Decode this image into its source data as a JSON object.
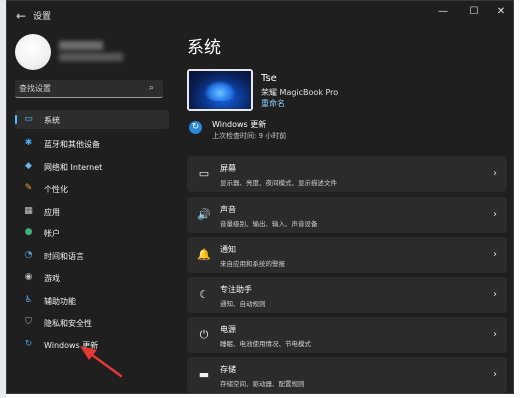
{
  "window": {
    "title": "设置",
    "back_glyph": "←",
    "minimize_glyph": "—",
    "maximize_glyph": "☐",
    "close_glyph": "✕"
  },
  "search": {
    "placeholder": "查找设置"
  },
  "sidebar": {
    "items": [
      {
        "label": "系统",
        "icon": "▭",
        "icon_name": "system-icon",
        "icon_color": "#4cc2ff",
        "active": true
      },
      {
        "label": "蓝牙和其他设备",
        "icon": "✱",
        "icon_name": "bluetooth-icon",
        "icon_color": "#4aa8f0",
        "active": false
      },
      {
        "label": "网络和 Internet",
        "icon": "◆",
        "icon_name": "network-icon",
        "icon_color": "#67b5f0",
        "active": false
      },
      {
        "label": "个性化",
        "icon": "✎",
        "icon_name": "personalization-icon",
        "icon_color": "#f0a030",
        "active": false
      },
      {
        "label": "应用",
        "icon": "▦",
        "icon_name": "apps-icon",
        "icon_color": "#c8c8c8",
        "active": false
      },
      {
        "label": "帐户",
        "icon": "●",
        "icon_name": "account-icon",
        "icon_color": "#3fb27f",
        "active": false
      },
      {
        "label": "时间和语言",
        "icon": "◔",
        "icon_name": "time-language-icon",
        "icon_color": "#52a8e8",
        "active": false
      },
      {
        "label": "游戏",
        "icon": "◉",
        "icon_name": "gaming-icon",
        "icon_color": "#b9b9b9",
        "active": false
      },
      {
        "label": "辅助功能",
        "icon": "♿",
        "icon_name": "accessibility-icon",
        "icon_color": "#5aa7e6",
        "active": false
      },
      {
        "label": "隐私和安全性",
        "icon": "⛉",
        "icon_name": "privacy-icon",
        "icon_color": "#a8a8a8",
        "active": false
      },
      {
        "label": "Windows 更新",
        "icon": "↻",
        "icon_name": "windows-update-icon",
        "icon_color": "#3aa0e6",
        "active": false
      }
    ]
  },
  "main": {
    "title": "系统",
    "device": {
      "name": "Tse",
      "model": "荣耀 MagicBook Pro",
      "rename": "重命名"
    },
    "update": {
      "title": "Windows 更新",
      "subtitle": "上次检查时间: 9 小时前",
      "icon": "↻"
    },
    "cards": [
      {
        "title": "屏幕",
        "subtitle": "显示器、亮度、夜间模式、显示描述文件",
        "icon": "▭",
        "icon_name": "display-icon"
      },
      {
        "title": "声音",
        "subtitle": "音量级别、输出、输入、声音设备",
        "icon": "🔊",
        "icon_name": "sound-icon"
      },
      {
        "title": "通知",
        "subtitle": "来自应用和系统的警报",
        "icon": "🔔",
        "icon_name": "notifications-icon"
      },
      {
        "title": "专注助手",
        "subtitle": "通知、自动规则",
        "icon": "☾",
        "icon_name": "focus-assist-icon"
      },
      {
        "title": "电源",
        "subtitle": "睡眠、电池使用情况、节电模式",
        "icon": "⏻",
        "icon_name": "power-icon"
      },
      {
        "title": "存储",
        "subtitle": "存储空间、驱动器、配置规则",
        "icon": "▬",
        "icon_name": "storage-icon"
      }
    ],
    "chevron": "›"
  },
  "colors": {
    "accent": "#4cc2ff",
    "annotation_arrow": "#e53935",
    "window_bg": "#1f1f1f",
    "card_bg": "#2b2b2b"
  }
}
